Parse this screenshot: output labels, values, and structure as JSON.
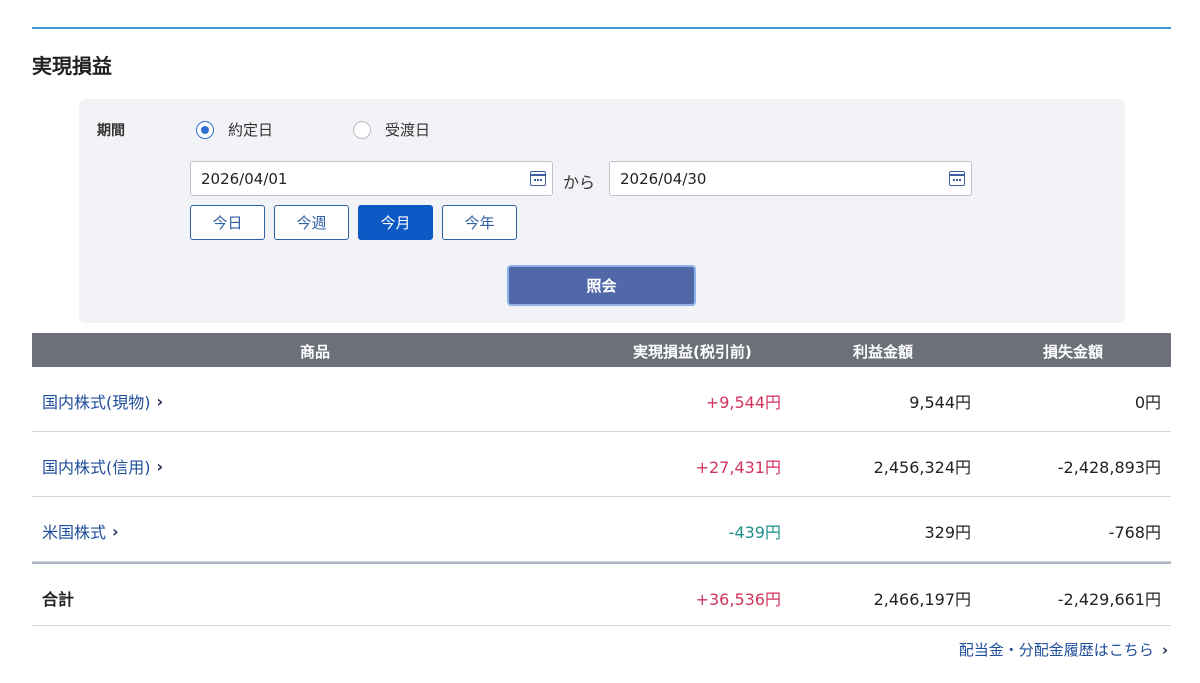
{
  "page": {
    "title": "実現損益"
  },
  "filter": {
    "period_label": "期間",
    "radio_trade_date": "約定日",
    "radio_settle_date": "受渡日",
    "selected_radio": "trade_date",
    "date_from": "2026/04/01",
    "date_to": "2026/04/30",
    "range_separator": "から",
    "quick_buttons": {
      "today": "今日",
      "week": "今週",
      "month": "今月",
      "year": "今年"
    },
    "active_quick": "month",
    "search_button": "照会"
  },
  "table": {
    "headers": {
      "product": "商品",
      "realized": "実現損益(税引前)",
      "profit": "利益金額",
      "loss": "損失金額"
    },
    "rows": [
      {
        "product": "国内株式(現物)",
        "realized": "+9,544円",
        "profit": "9,544円",
        "loss": "0円"
      },
      {
        "product": "国内株式(信用)",
        "realized": "+27,431円",
        "profit": "2,456,324円",
        "loss": "-2,428,893円"
      },
      {
        "product": "米国株式",
        "realized": "-439円",
        "profit": "329円",
        "loss": "-768円"
      }
    ],
    "total": {
      "label": "合計",
      "realized": "+36,536円",
      "profit": "2,466,197円",
      "loss": "-2,429,661円"
    }
  },
  "footer": {
    "history_link": "配当金・分配金履歴はこちら"
  },
  "colors": {
    "accent_rule": "#3f9ad8",
    "positive": "#d2335c",
    "negative": "#1f8f8a",
    "link": "#1f4e9a",
    "active_button": "#0c58c4"
  }
}
